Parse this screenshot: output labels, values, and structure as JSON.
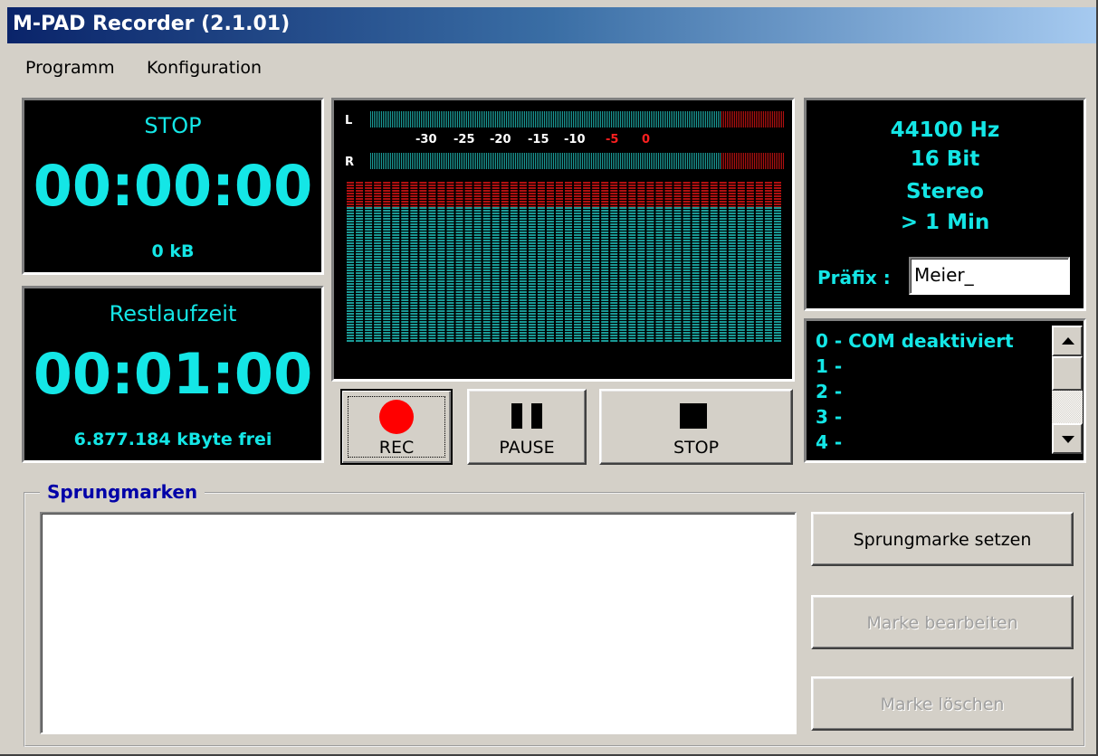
{
  "window": {
    "title": "M-PAD Recorder (2.1.01)"
  },
  "menu": {
    "items": [
      "Programm",
      "Konfiguration"
    ]
  },
  "status_panel": {
    "state": "STOP",
    "elapsed": "00:00:00",
    "size": "0 kB"
  },
  "remaining_panel": {
    "label": "Restlaufzeit",
    "time": "00:01:00",
    "free": "6.877.184 kByte frei"
  },
  "meter": {
    "left_label": "L",
    "right_label": "R",
    "scale": [
      "-30",
      "-25",
      "-20",
      "-15",
      "-10",
      "-5",
      "0"
    ],
    "level_color": "#1a9a96",
    "peak_color": "#b01010"
  },
  "format_panel": {
    "rate": "44100 Hz",
    "bits": "16 Bit",
    "channels": "Stereo",
    "duration": "> 1 Min",
    "prefix_label": "Präfix :",
    "prefix_value": "Meier_"
  },
  "com_list": {
    "items": [
      "0 - COM deaktiviert",
      "1 -",
      "2 -",
      "3 -",
      "4 -"
    ]
  },
  "transport": {
    "rec_label": "REC",
    "pause_label": "PAUSE",
    "stop_label": "STOP",
    "rec_color": "#ff0000"
  },
  "markers": {
    "group_title": "Sprungmarken",
    "set_label": "Sprungmarke setzen",
    "edit_label": "Marke bearbeiten",
    "delete_label": "Marke löschen"
  },
  "colors": {
    "accent_cyan": "#14e6e6",
    "panel_bg": "#000000",
    "window_bg": "#d4d0c8"
  }
}
